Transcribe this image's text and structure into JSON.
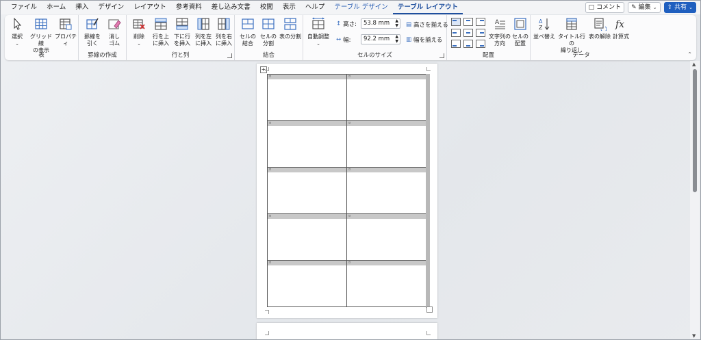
{
  "menu": {
    "tabs": [
      "ファイル",
      "ホーム",
      "挿入",
      "デザイン",
      "レイアウト",
      "参考資料",
      "差し込み文書",
      "校閲",
      "表示",
      "ヘルプ"
    ],
    "context_tab_design": "テーブル デザイン",
    "context_tab_layout": "テーブル レイアウト",
    "comment_button": "コメント",
    "edit_button": "編集",
    "share_button": "共有"
  },
  "ribbon": {
    "table_group": {
      "label": "表",
      "select": "選択",
      "gridlines_1": "グリッド線",
      "gridlines_2": "の表示",
      "properties": "プロパティ"
    },
    "draw_group": {
      "label": "罫線の作成",
      "draw_1": "罫線を",
      "draw_2": "引く",
      "eraser_1": "消し",
      "eraser_2": "ゴム"
    },
    "rows_cols_group": {
      "label": "行と列",
      "delete": "削除",
      "insert_above_1": "行を上",
      "insert_above_2": "に挿入",
      "insert_below_1": "下に行",
      "insert_below_2": "を挿入",
      "insert_left_1": "列を左",
      "insert_left_2": "に挿入",
      "insert_right_1": "列を右",
      "insert_right_2": "に挿入"
    },
    "merge_group": {
      "label": "結合",
      "merge_1": "セルの",
      "merge_2": "結合",
      "split_1": "セルの",
      "split_2": "分割",
      "split_table": "表の分割"
    },
    "cell_size_group": {
      "label": "セルのサイズ",
      "autofit": "自動調整",
      "height_label": "高さ:",
      "height_value": "53.8 mm",
      "width_label": "幅:",
      "width_value": "92.2 mm",
      "distribute_rows": "高さを揃える",
      "distribute_cols": "幅を揃える"
    },
    "alignment_group": {
      "label": "配置",
      "text_direction_1": "文字列の",
      "text_direction_2": "方向",
      "cell_margins_1": "セルの",
      "cell_margins_2": "配置"
    },
    "data_group": {
      "label": "データ",
      "sort": "並べ替え",
      "repeat_header_1": "タイトル行の",
      "repeat_header_2": "繰り返し",
      "convert": "表の解除",
      "formula": "計算式"
    }
  },
  "document": {
    "table": {
      "rows": 5,
      "cols": 2
    }
  },
  "icons": {
    "select": "select-cursor-icon",
    "gridlines": "gridlines-icon",
    "properties": "properties-icon",
    "draw": "draw-table-icon",
    "eraser": "eraser-icon",
    "delete": "delete-table-icon",
    "formula": "fx-icon"
  },
  "colors": {
    "accent": "#1f4f9e",
    "share": "#1f5fbf"
  }
}
